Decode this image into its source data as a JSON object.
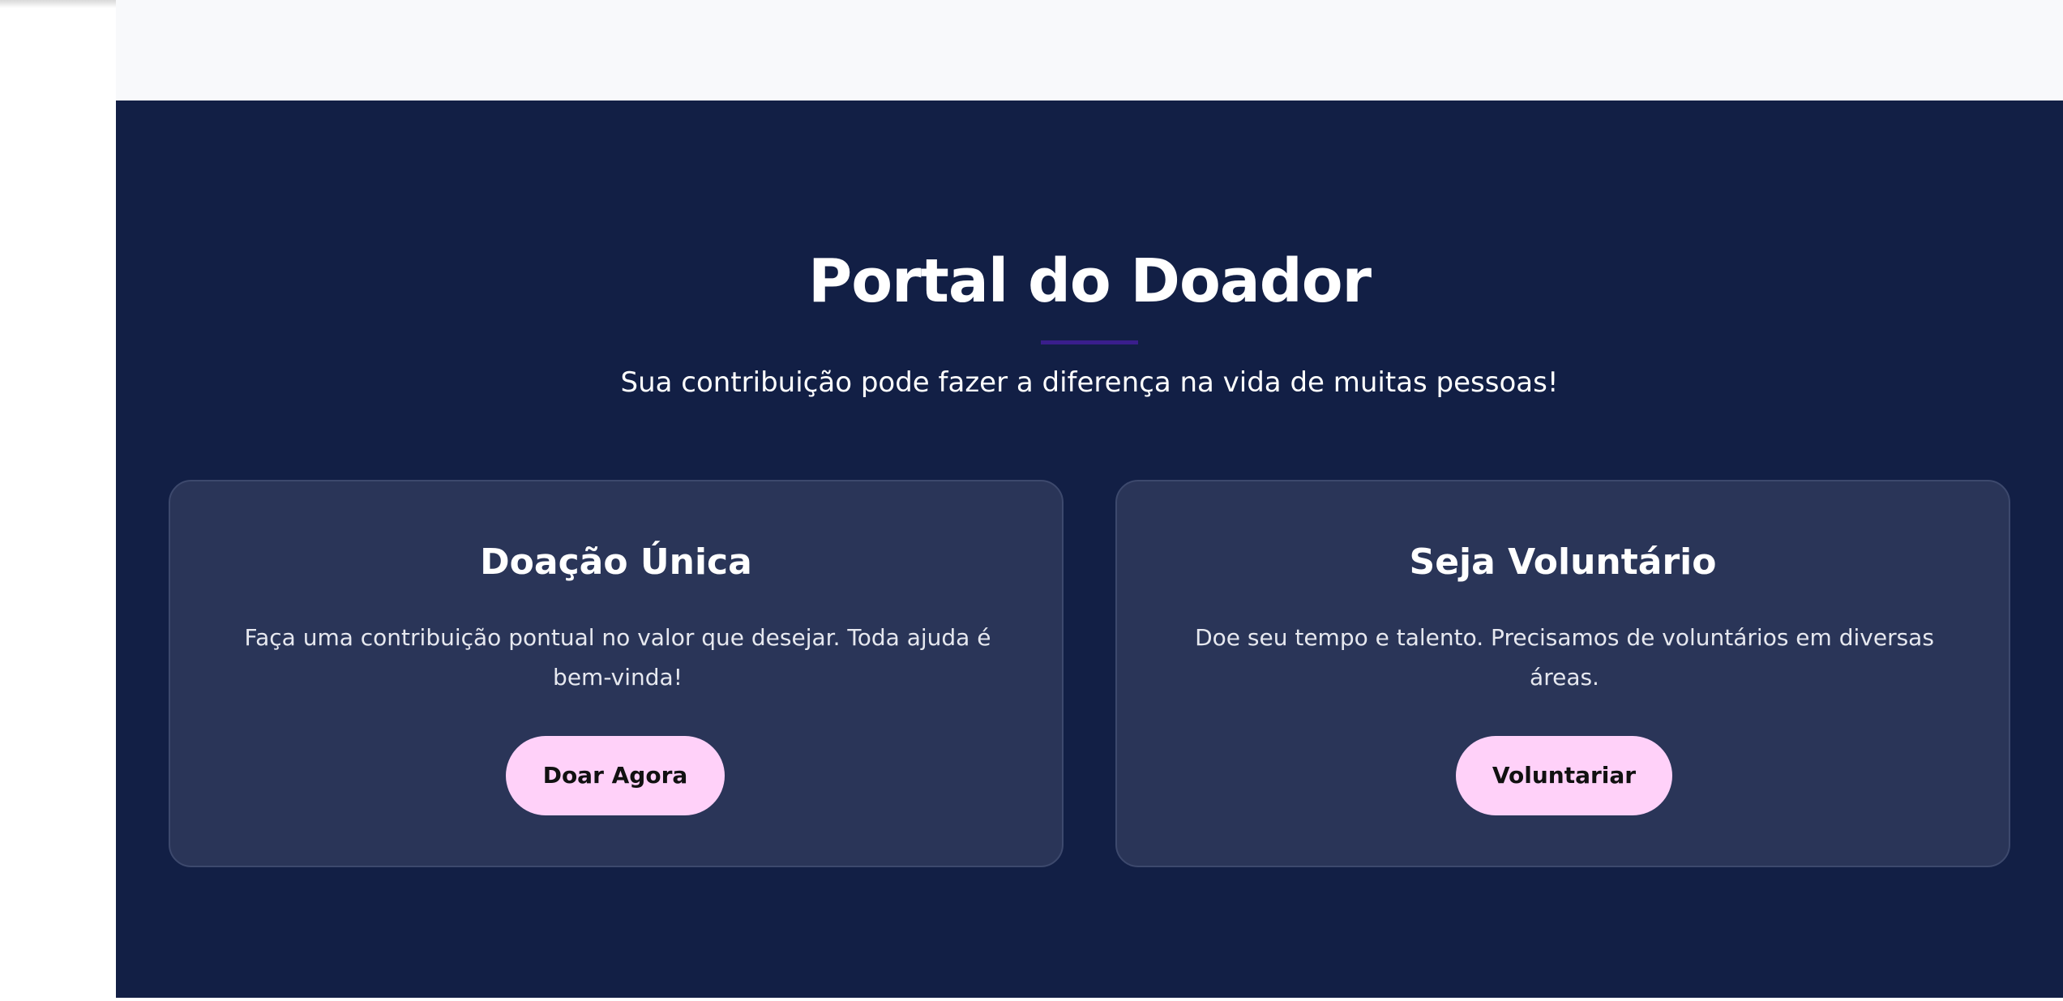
{
  "portal": {
    "title": "Portal do Doador",
    "subtitle": "Sua contribuição pode fazer a diferença na vida de muitas pessoas!"
  },
  "cards": [
    {
      "title": "Doação Única",
      "text": "Faça uma contribuição pontual no valor que desejar. Toda ajuda é bem-vinda!",
      "button_label": "Doar Agora"
    },
    {
      "title": "Seja Voluntário",
      "text": "Doe seu tempo e talento. Precisamos de voluntários em diversas áreas.",
      "button_label": "Voluntariar"
    }
  ],
  "colors": {
    "section_background": "#121f45",
    "card_background": "#2a3558",
    "card_border": "#3d496d",
    "button_background": "#ffd1f9",
    "title_accent": "#3a1e8c",
    "top_band": "#f8f9fb"
  }
}
